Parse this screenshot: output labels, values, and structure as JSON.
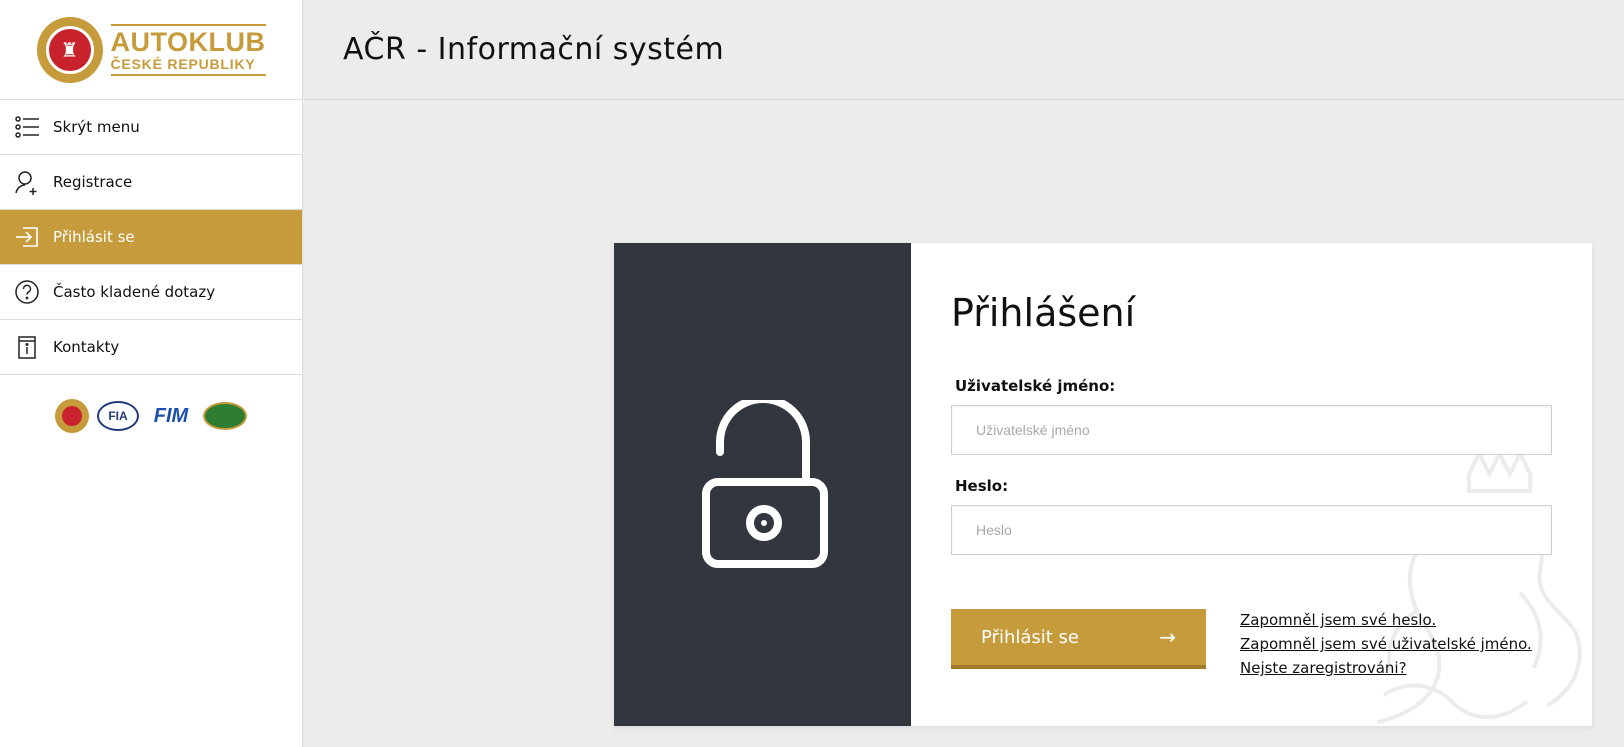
{
  "logo": {
    "line1": "AUTOKLUB",
    "line2": "ČESKÉ REPUBLIKY"
  },
  "header": {
    "title": "AČR - Informační systém"
  },
  "sidebar": {
    "items": [
      {
        "label": "Skrýt menu",
        "icon": "list-icon",
        "active": false
      },
      {
        "label": "Registrace",
        "icon": "user-add-icon",
        "active": false
      },
      {
        "label": "Přihlásit se",
        "icon": "login-icon",
        "active": true
      },
      {
        "label": "Často kladené dotazy",
        "icon": "question-icon",
        "active": false
      },
      {
        "label": "Kontakty",
        "icon": "info-card-icon",
        "active": false
      }
    ],
    "partners": {
      "fia": "FIA",
      "fim": "FIM"
    }
  },
  "login": {
    "title": "Přihlášení",
    "username_label": "Uživatelské jméno:",
    "username_placeholder": "Uživatelské jméno",
    "password_label": "Heslo:",
    "password_placeholder": "Heslo",
    "submit_label": "Přihlásit se",
    "links": {
      "forgot_password": "Zapomněl jsem své heslo.",
      "forgot_username": "Zapomněl jsem své uživatelské jméno.",
      "not_registered": "Nejste zaregistrováni?"
    }
  },
  "colors": {
    "accent": "#c69b3b",
    "dark_panel": "#32363f",
    "background": "#ececec"
  }
}
